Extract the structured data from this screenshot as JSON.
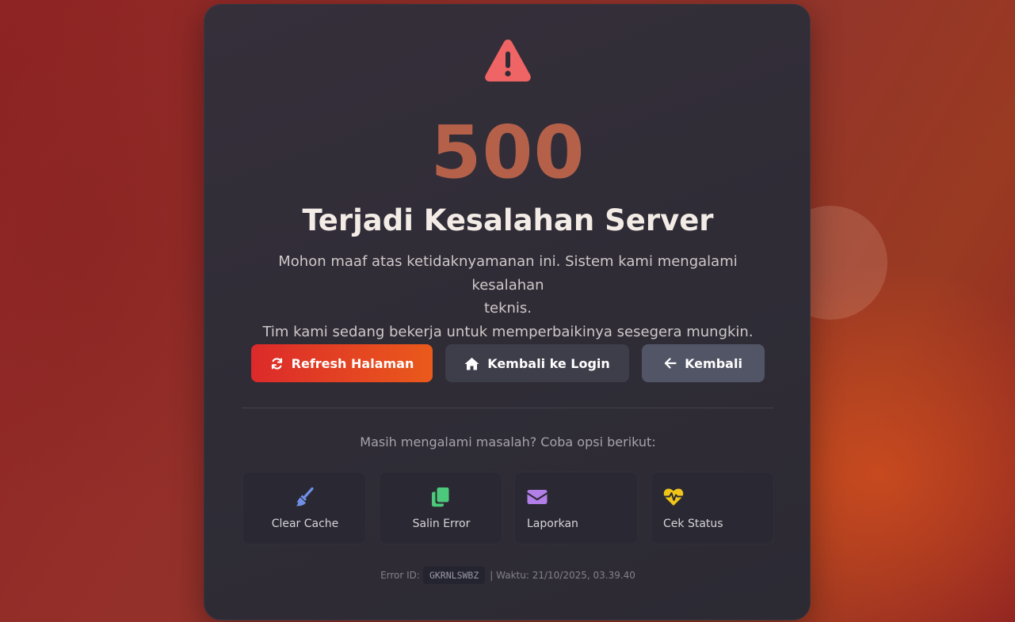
{
  "error": {
    "code": "500",
    "title": "Terjadi Kesalahan Server",
    "description_line1": "Mohon maaf atas ketidaknyamanan ini. Sistem kami mengalami kesalahan",
    "description_line2": "teknis.",
    "description_line3": "Tim kami sedang bekerja untuk memperbaikinya sesegera mungkin."
  },
  "icons": {
    "main": "warning-triangle-icon",
    "refresh": "refresh-icon",
    "home": "home-icon",
    "back": "arrow-left-icon",
    "clear_cache": "broom-icon",
    "copy": "copy-icon",
    "report": "envelope-icon",
    "status": "heartbeat-icon"
  },
  "buttons": {
    "refresh_label": "Refresh Halaman",
    "login_label": "Kembali ke Login",
    "back_label": "Kembali"
  },
  "help": {
    "prompt": "Masih mengalami masalah? Coba opsi berikut:",
    "options": [
      {
        "label": "Clear Cache"
      },
      {
        "label": "Salin Error"
      },
      {
        "label": "Laporkan"
      },
      {
        "label": "Cek Status"
      }
    ]
  },
  "footer": {
    "error_id_label": "Error ID:",
    "error_id": "GKRNLSWBZ",
    "time_text": "| Waktu: 21/10/2025, 03.39.40"
  },
  "colors": {
    "warning": "#ef6464",
    "code": "#b5614a",
    "refresh_start": "#dc2a2a",
    "refresh_end": "#ea5a1b",
    "clear_cache_icon": "#6f8fe6",
    "copy_icon": "#4cc97a",
    "report_icon": "#b27ee8",
    "status_icon": "#f0c419"
  }
}
